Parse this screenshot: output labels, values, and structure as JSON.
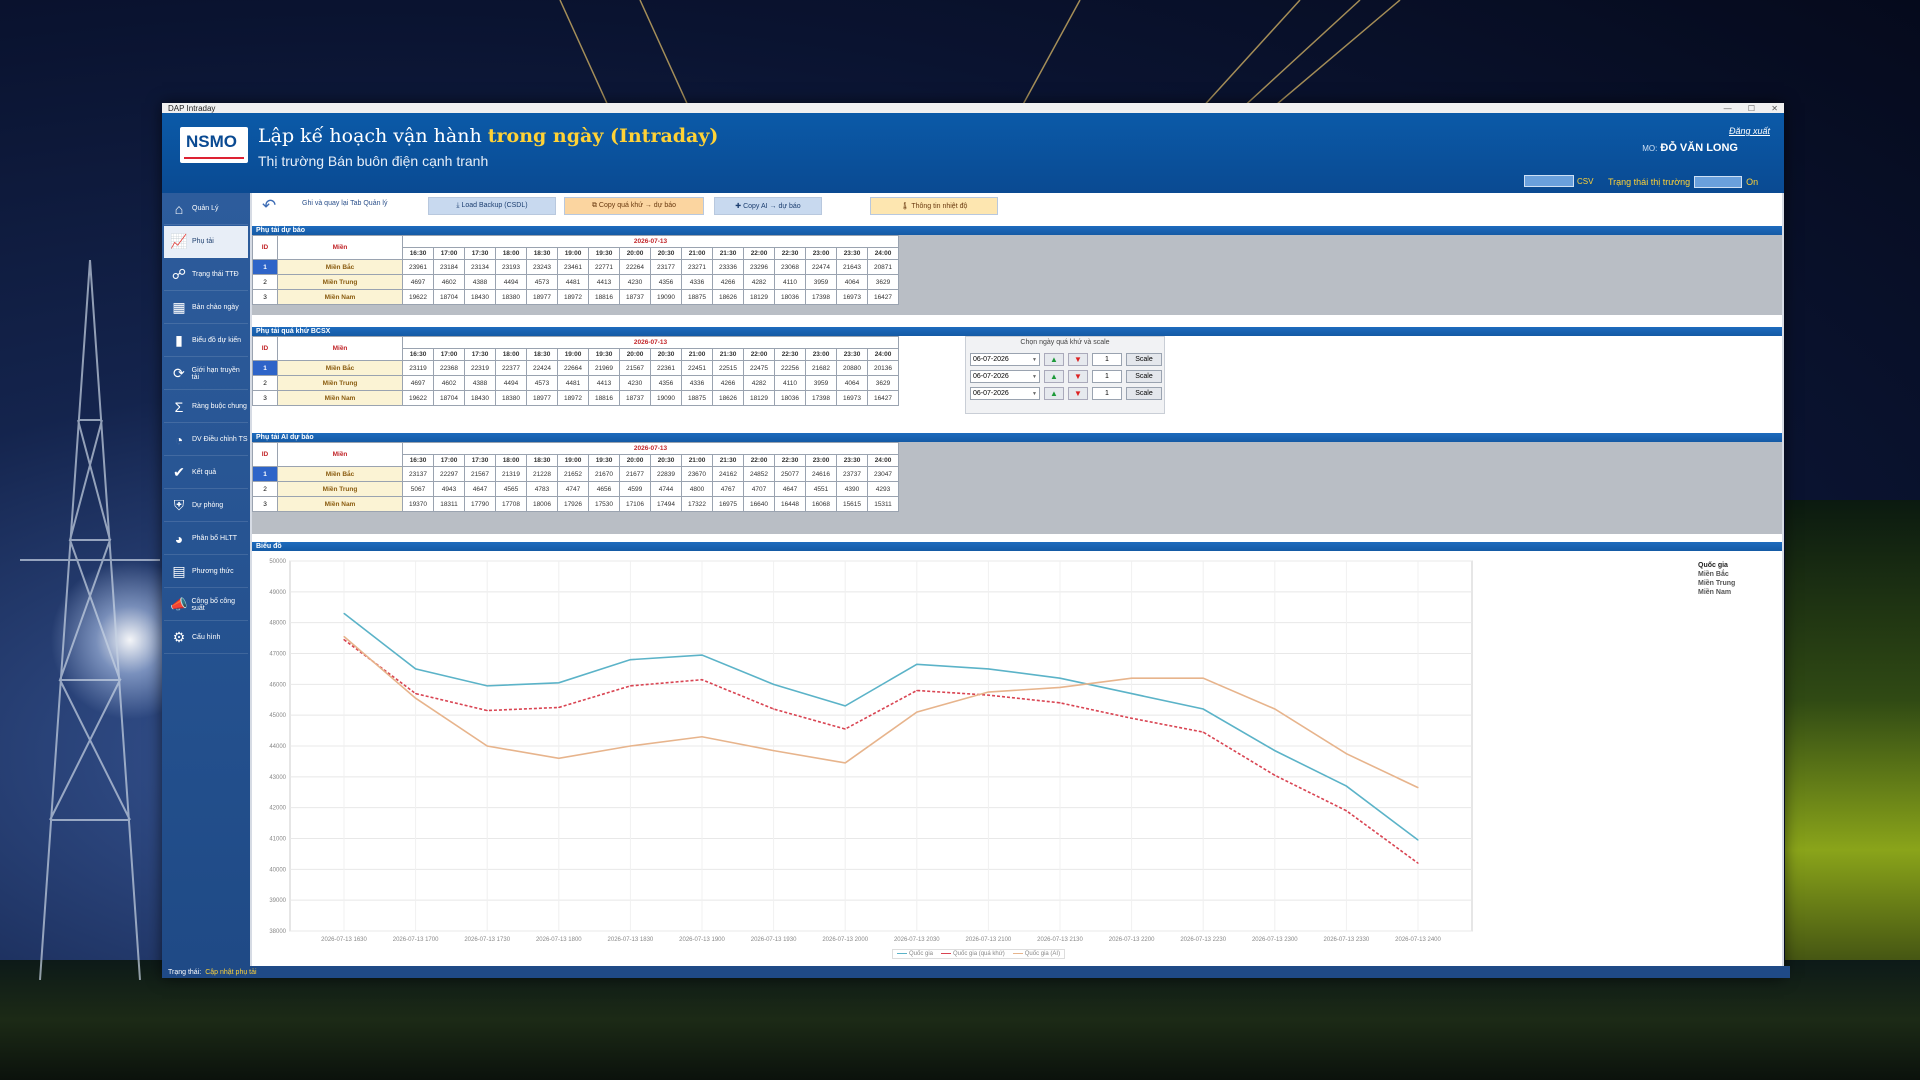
{
  "window": {
    "title": "DAP Intraday"
  },
  "header": {
    "logo_text": "NSMO",
    "title_prefix": "Lập kế hoạch vận hành",
    "title_highlight": "trong ngày (Intraday)",
    "subtitle": "Thị trường Bán buôn điện cạnh tranh",
    "logout": "Đăng xuất",
    "user_prefix": "MO:",
    "user_name": "ĐỖ VĂN LONG",
    "csv_label": "CSV",
    "market_label": "Trạng thái thị trường",
    "market_value": "On"
  },
  "sidebar": {
    "items": [
      {
        "label": "Quản Lý",
        "icon": "house-icon"
      },
      {
        "label": "Phụ tải",
        "icon": "chart-person-icon"
      },
      {
        "label": "Trạng thái TTĐ",
        "icon": "network-icon"
      },
      {
        "label": "Bản chào ngày",
        "icon": "table-icon"
      },
      {
        "label": "Biểu đồ dự kiến",
        "icon": "bar-chart-icon"
      },
      {
        "label": "Giới hạn truyền tải",
        "icon": "refresh-icon"
      },
      {
        "label": "Ràng buộc chung",
        "icon": "sigma-icon"
      },
      {
        "label": "DV Điều chỉnh TS",
        "icon": "gauge-icon"
      },
      {
        "label": "Kết quả",
        "icon": "result-icon"
      },
      {
        "label": "Dự phòng",
        "icon": "shield-icon"
      },
      {
        "label": "Phân bổ HLTT",
        "icon": "pie-icon"
      },
      {
        "label": "Phương thức",
        "icon": "document-icon"
      },
      {
        "label": "Công bố công suất",
        "icon": "announce-icon"
      },
      {
        "label": "Cấu hình",
        "icon": "gear-icon"
      }
    ]
  },
  "toolbar": {
    "back_label": "Ghi và quay lại Tab Quản lý",
    "load_backup": "⤓ Load Backup (CSDL)",
    "copy_hist": "⧉ Copy quá khứ → dự báo",
    "copy_ai": "✚ Copy AI → dự báo",
    "weather": "🌡 Thông tin nhiệt độ"
  },
  "times": [
    "16:30",
    "17:00",
    "17:30",
    "18:00",
    "18:30",
    "19:00",
    "19:30",
    "20:00",
    "20:30",
    "21:00",
    "21:30",
    "22:00",
    "22:30",
    "23:00",
    "23:30",
    "24:00"
  ],
  "col_id": "ID",
  "col_mien": "Miền",
  "date": "2026-07-13",
  "forecast": {
    "title": "Phụ tải dự báo",
    "rows": [
      {
        "id": "1",
        "name": "Miền Bắc",
        "values": [
          "23961",
          "23184",
          "23134",
          "23193",
          "23243",
          "23461",
          "22771",
          "22264",
          "23177",
          "23271",
          "23336",
          "23296",
          "23068",
          "22474",
          "21643",
          "20871"
        ]
      },
      {
        "id": "2",
        "name": "Miền Trung",
        "values": [
          "4697",
          "4602",
          "4388",
          "4494",
          "4573",
          "4481",
          "4413",
          "4230",
          "4356",
          "4336",
          "4266",
          "4282",
          "4110",
          "3959",
          "4064",
          "3629"
        ]
      },
      {
        "id": "3",
        "name": "Miền Nam",
        "values": [
          "19622",
          "18704",
          "18430",
          "18380",
          "18977",
          "18972",
          "18816",
          "18737",
          "19090",
          "18875",
          "18626",
          "18129",
          "18036",
          "17398",
          "16973",
          "16427"
        ]
      }
    ]
  },
  "history": {
    "title": "Phụ tải quá khứ BCSX",
    "rows": [
      {
        "id": "1",
        "name": "Miền Bắc",
        "values": [
          "23119",
          "22368",
          "22319",
          "22377",
          "22424",
          "22664",
          "21969",
          "21567",
          "22361",
          "22451",
          "22515",
          "22475",
          "22256",
          "21682",
          "20880",
          "20136"
        ]
      },
      {
        "id": "2",
        "name": "Miền Trung",
        "values": [
          "4697",
          "4602",
          "4388",
          "4494",
          "4573",
          "4481",
          "4413",
          "4230",
          "4356",
          "4336",
          "4266",
          "4282",
          "4110",
          "3959",
          "4064",
          "3629"
        ]
      },
      {
        "id": "3",
        "name": "Miền Nam",
        "values": [
          "19622",
          "18704",
          "18430",
          "18380",
          "18977",
          "18972",
          "18816",
          "18737",
          "19090",
          "18875",
          "18626",
          "18129",
          "18036",
          "17398",
          "16973",
          "16427"
        ]
      }
    ],
    "picker_title": "Chọn ngày quá khứ và scale",
    "picker_rows": [
      {
        "date": "06-07-2026",
        "num": "1",
        "scale": "Scale"
      },
      {
        "date": "06-07-2026",
        "num": "1",
        "scale": "Scale"
      },
      {
        "date": "06-07-2026",
        "num": "1",
        "scale": "Scale"
      }
    ]
  },
  "ai": {
    "title": "Phụ tải AI dự báo",
    "rows": [
      {
        "id": "1",
        "name": "Miền Bắc",
        "values": [
          "23137",
          "22297",
          "21567",
          "21319",
          "21228",
          "21652",
          "21670",
          "21677",
          "22839",
          "23670",
          "24162",
          "24852",
          "25077",
          "24616",
          "23737",
          "23047"
        ]
      },
      {
        "id": "2",
        "name": "Miền Trung",
        "values": [
          "5067",
          "4943",
          "4647",
          "4565",
          "4783",
          "4747",
          "4656",
          "4599",
          "4744",
          "4800",
          "4767",
          "4707",
          "4647",
          "4551",
          "4390",
          "4293"
        ]
      },
      {
        "id": "3",
        "name": "Miền Nam",
        "values": [
          "19370",
          "18311",
          "17790",
          "17708",
          "18006",
          "17926",
          "17530",
          "17106",
          "17494",
          "17322",
          "16975",
          "16640",
          "16448",
          "16068",
          "15615",
          "15311"
        ]
      }
    ]
  },
  "chart_section_title": "Biểu đồ",
  "chart_data": {
    "type": "line",
    "title": "",
    "x": [
      "2026-07-13 1630",
      "2026-07-13 1700",
      "2026-07-13 1730",
      "2026-07-13 1800",
      "2026-07-13 1830",
      "2026-07-13 1900",
      "2026-07-13 1930",
      "2026-07-13 2000",
      "2026-07-13 2030",
      "2026-07-13 2100",
      "2026-07-13 2130",
      "2026-07-13 2200",
      "2026-07-13 2230",
      "2026-07-13 2300",
      "2026-07-13 2330",
      "2026-07-13 2400"
    ],
    "ylim": [
      38000,
      50000
    ],
    "yticks": [
      38000,
      39000,
      40000,
      41000,
      42000,
      43000,
      44000,
      45000,
      46000,
      47000,
      48000,
      49000,
      50000
    ],
    "series": [
      {
        "name": "Quốc gia",
        "color": "#5bb3c8",
        "dash": "none",
        "values": [
          48300,
          46500,
          45950,
          46050,
          46800,
          46950,
          46000,
          45300,
          46650,
          46500,
          46200,
          45700,
          45200,
          43850,
          42700,
          40950
        ]
      },
      {
        "name": "Quốc gia (quá khứ)",
        "color": "#d94452",
        "dash": "3,2",
        "values": [
          47450,
          45700,
          45150,
          45250,
          45950,
          46150,
          45200,
          44550,
          45800,
          45650,
          45400,
          44900,
          44450,
          43050,
          41900,
          40200
        ]
      },
      {
        "name": "Quốc gia (AI)",
        "color": "#e7b48c",
        "dash": "none",
        "values": [
          47550,
          45550,
          44000,
          43600,
          44000,
          44300,
          43850,
          43450,
          45100,
          45750,
          45900,
          46200,
          46200,
          45200,
          43750,
          42650
        ]
      }
    ],
    "legend_right": [
      "Quốc gia",
      "Miền Bắc",
      "Miền Trung",
      "Miền Nam"
    ],
    "grid": true
  },
  "status": {
    "label": "Trạng thái:",
    "value": "Cập nhật phụ tải"
  }
}
